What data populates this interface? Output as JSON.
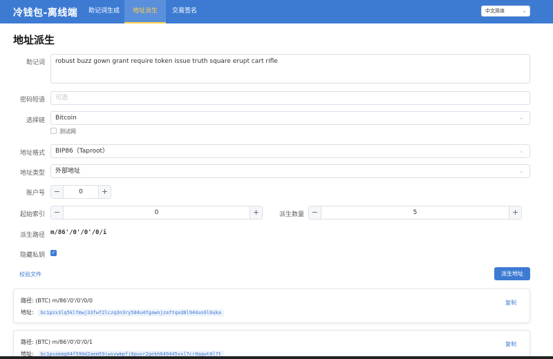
{
  "app": {
    "title": "冷钱包-离线端",
    "nav": [
      {
        "label": "助记词生成",
        "active": false
      },
      {
        "label": "地址派生",
        "active": true
      },
      {
        "label": "交易签名",
        "active": false
      }
    ],
    "language": "中文简体"
  },
  "page": {
    "title": "地址派生"
  },
  "form": {
    "mnemonic": {
      "label": "助记词",
      "value": "robust buzz gown grant require token issue truth square erupt cart rifle"
    },
    "passphrase": {
      "label": "密码短语",
      "placeholder": "可选"
    },
    "chain": {
      "label": "选择链",
      "value": "Bitcoin",
      "testnet_label": "测试网"
    },
    "format": {
      "label": "地址格式",
      "value": "BIP86（Taproot）"
    },
    "address_type": {
      "label": "地址类型",
      "value": "外部地址"
    },
    "account": {
      "label": "账户号",
      "value": "0"
    },
    "start_index": {
      "label": "起始索引",
      "value": "0"
    },
    "count": {
      "label": "派生数量",
      "value": "5"
    },
    "path": {
      "label": "派生路径",
      "value": "m/86'/0'/0'/0/i"
    },
    "hide_private": {
      "label": "隐藏私钥",
      "checked": true
    }
  },
  "actions": {
    "verify_file": "校验文件",
    "derive": "派生地址"
  },
  "results": [
    {
      "path_label": "路径:",
      "path": "(BTC) m/86'/0'/0'/0/0",
      "address_label": "地址:",
      "address": "bc1pzx3lq5klfmwj33fwf2lczq3n3ry584u4fgawnjzaftqxd8l944us6l0uka",
      "copy": "复制"
    },
    {
      "path_label": "路径:",
      "path": "(BTC) m/86'/0'/0'/0/1",
      "address_label": "地址:",
      "address": "bc1pvakmg04f590d2aem59jwsvwmpfj0puvr2gekh649445vxl7cr0qqwt0l7t",
      "copy": "复制"
    }
  ],
  "icons": {
    "chevron": "chevron-down-icon",
    "check": "check-icon",
    "minus": "minus-icon",
    "plus": "plus-icon"
  },
  "colors": {
    "primary": "#3d7bd3",
    "active_tab_text": "#ffd04b"
  }
}
